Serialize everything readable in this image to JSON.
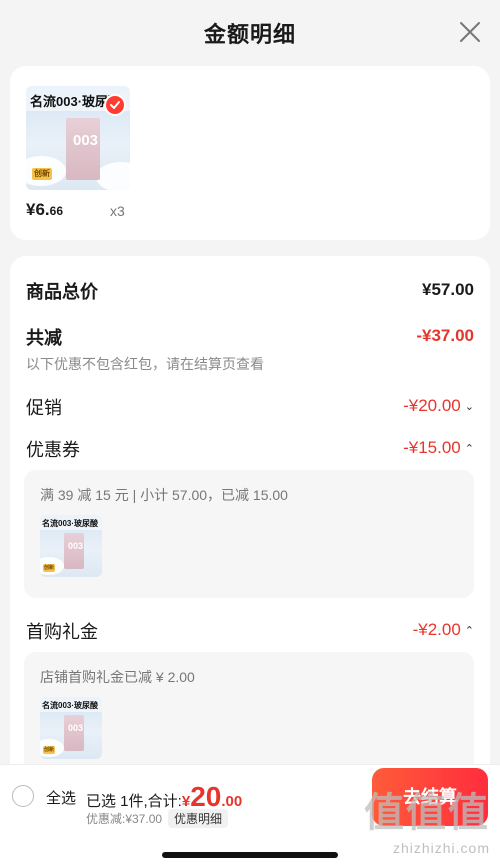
{
  "header": {
    "title": "金额明细"
  },
  "product": {
    "thumb_banner": "名流003·玻尿酸",
    "thumb_box_text": "003",
    "thumb_badge": "创新",
    "price_main": "¥6.",
    "price_cents": "66",
    "qty": "x3"
  },
  "summary": {
    "total_label": "商品总价",
    "total_value": "¥57.00",
    "reduce_label": "共减",
    "reduce_value": "-¥37.00",
    "note": "以下优惠不包含红包，请在结算页查看",
    "promo_label": "促销",
    "promo_value": "-¥20.00",
    "coupon_label": "优惠券",
    "coupon_value": "-¥15.00",
    "coupon_detail": "满 39 减 15 元 | 小计 57.00，已减 15.00",
    "firstbuy_label": "首购礼金",
    "firstbuy_value": "-¥2.00",
    "firstbuy_detail": "店铺首购礼金已减 ¥ 2.00"
  },
  "bottom": {
    "select_all": "全选",
    "selected_text": "已选 1件,合计:",
    "currency": "¥",
    "amount_int": "20",
    "amount_dec": ".00",
    "discount_text": "优惠减:¥37.00",
    "detail_tag": "优惠明细",
    "checkout": "去结算"
  },
  "watermark": {
    "logo": "值值值",
    "url": "zhizhizhi.com"
  },
  "colors": {
    "accent": "#e8352c",
    "checkout_start": "#ff5b3a",
    "checkout_end": "#ff2d3d"
  }
}
